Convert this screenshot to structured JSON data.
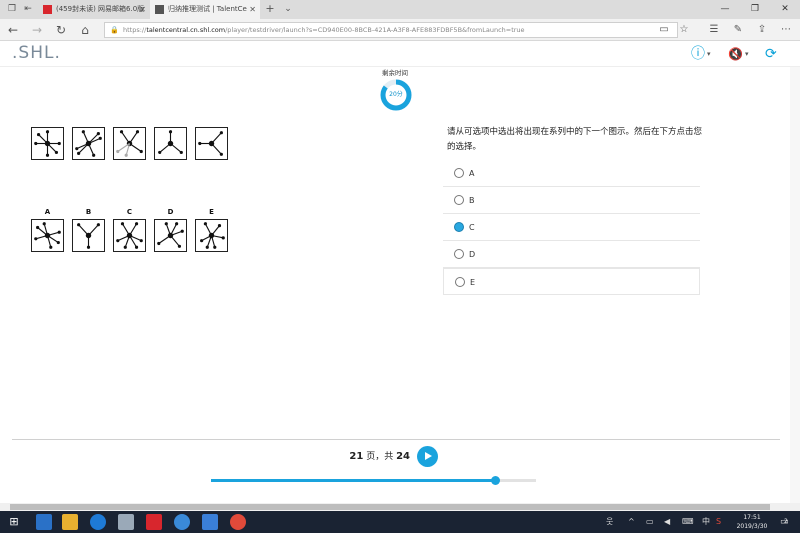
{
  "browser": {
    "tabs": [
      {
        "title": "(459封未读) 网易邮箱6.0版",
        "active": false
      },
      {
        "title": "归纳推理测试 | TalentCe",
        "active": true
      }
    ],
    "new_tab": "+",
    "tab_menu": "⌄",
    "url_prefix": "https://",
    "url_domain": "talentcentral.cn.shl.com",
    "url_path": "/player/testdriver/launch?s=CD940E00-8BCB-421A-A3F8-AFE883FDBF5B&fromLaunch=true"
  },
  "header": {
    "logo": ".SHL."
  },
  "timer": {
    "label": "剩余时间",
    "value": "20分",
    "fraction_remaining": 0.85
  },
  "question": {
    "series_count": 5,
    "options": [
      {
        "letter": "A",
        "selected": false
      },
      {
        "letter": "B",
        "selected": false
      },
      {
        "letter": "C",
        "selected": true
      },
      {
        "letter": "D",
        "selected": false
      },
      {
        "letter": "E",
        "selected": false
      }
    ],
    "instruction": "请从可选项中选出将出现在系列中的下一个图示。然后在下方点击您的选择。"
  },
  "footer": {
    "page_current": "21",
    "page_text_mid": " 页，共 ",
    "page_total": "24",
    "progress_fraction": 0.875
  },
  "taskbar": {
    "clock_time": "17:51",
    "clock_date": "2019/3/30",
    "ime": "中",
    "notification_count": "2"
  },
  "colors": {
    "accent": "#1aa3dd",
    "logo_green": "#8cc63f",
    "taskbar": "#1a2333"
  }
}
